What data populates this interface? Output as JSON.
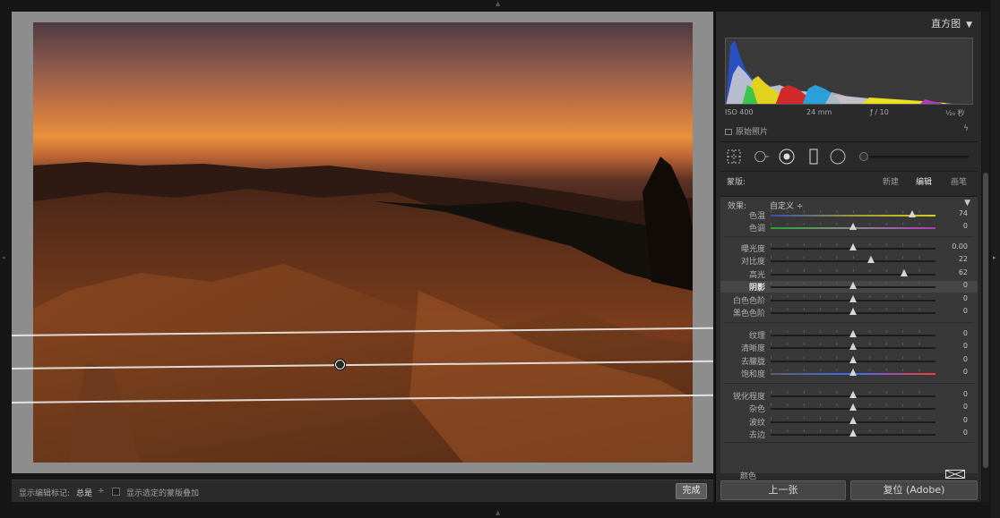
{
  "panel": {
    "histogram_title": "直方图",
    "camera": {
      "iso": "ISO 400",
      "focal": "24 mm",
      "aperture": "ƒ / 10",
      "shutter": "¹⁄₂₀ 秒"
    },
    "original_photo": "原始照片"
  },
  "mask": {
    "label": "蒙版:",
    "new": "新建",
    "edit": "编辑",
    "brush": "画笔"
  },
  "effect": {
    "label": "效果:",
    "value": "自定义 ÷"
  },
  "sliders": [
    {
      "label": "色温",
      "value": "74",
      "pos": 0.86,
      "track": "temp"
    },
    {
      "label": "色调",
      "value": "0",
      "pos": 0.5,
      "track": "tint"
    },
    {
      "label": "曝光度",
      "value": "0.00",
      "pos": 0.5,
      "track": "plain"
    },
    {
      "label": "对比度",
      "value": "22",
      "pos": 0.61,
      "track": "plain"
    },
    {
      "label": "高光",
      "value": "62",
      "pos": 0.81,
      "track": "plain"
    },
    {
      "label": "阴影",
      "value": "0",
      "pos": 0.5,
      "track": "plain"
    },
    {
      "label": "白色色阶",
      "value": "0",
      "pos": 0.5,
      "track": "plain"
    },
    {
      "label": "黑色色阶",
      "value": "0",
      "pos": 0.5,
      "track": "plain"
    },
    {
      "label": "纹理",
      "value": "0",
      "pos": 0.5,
      "track": "plain"
    },
    {
      "label": "清晰度",
      "value": "0",
      "pos": 0.5,
      "track": "plain"
    },
    {
      "label": "去朦胧",
      "value": "0",
      "pos": 0.5,
      "track": "plain"
    },
    {
      "label": "饱和度",
      "value": "0",
      "pos": 0.5,
      "track": "sat"
    },
    {
      "label": "锐化程度",
      "value": "0",
      "pos": 0.5,
      "track": "plain"
    },
    {
      "label": "杂色",
      "value": "0",
      "pos": 0.5,
      "track": "plain"
    },
    {
      "label": "波纹",
      "value": "0",
      "pos": 0.5,
      "track": "plain"
    },
    {
      "label": "去边",
      "value": "0",
      "pos": 0.5,
      "track": "plain"
    }
  ],
  "color_label": "颜色",
  "buttons": {
    "previous": "上一张",
    "reset": "复位 (Adobe)"
  },
  "toolbar": {
    "show_pins_label": "显示编辑标记:",
    "show_pins_value": "总是",
    "overlay_label": "显示选定的蒙版叠加",
    "done": "完成"
  },
  "colors": {
    "accent_orange": "#e8913a",
    "panel_bg": "#2a2a2a",
    "canvas_bg": "#8d8d8d"
  }
}
